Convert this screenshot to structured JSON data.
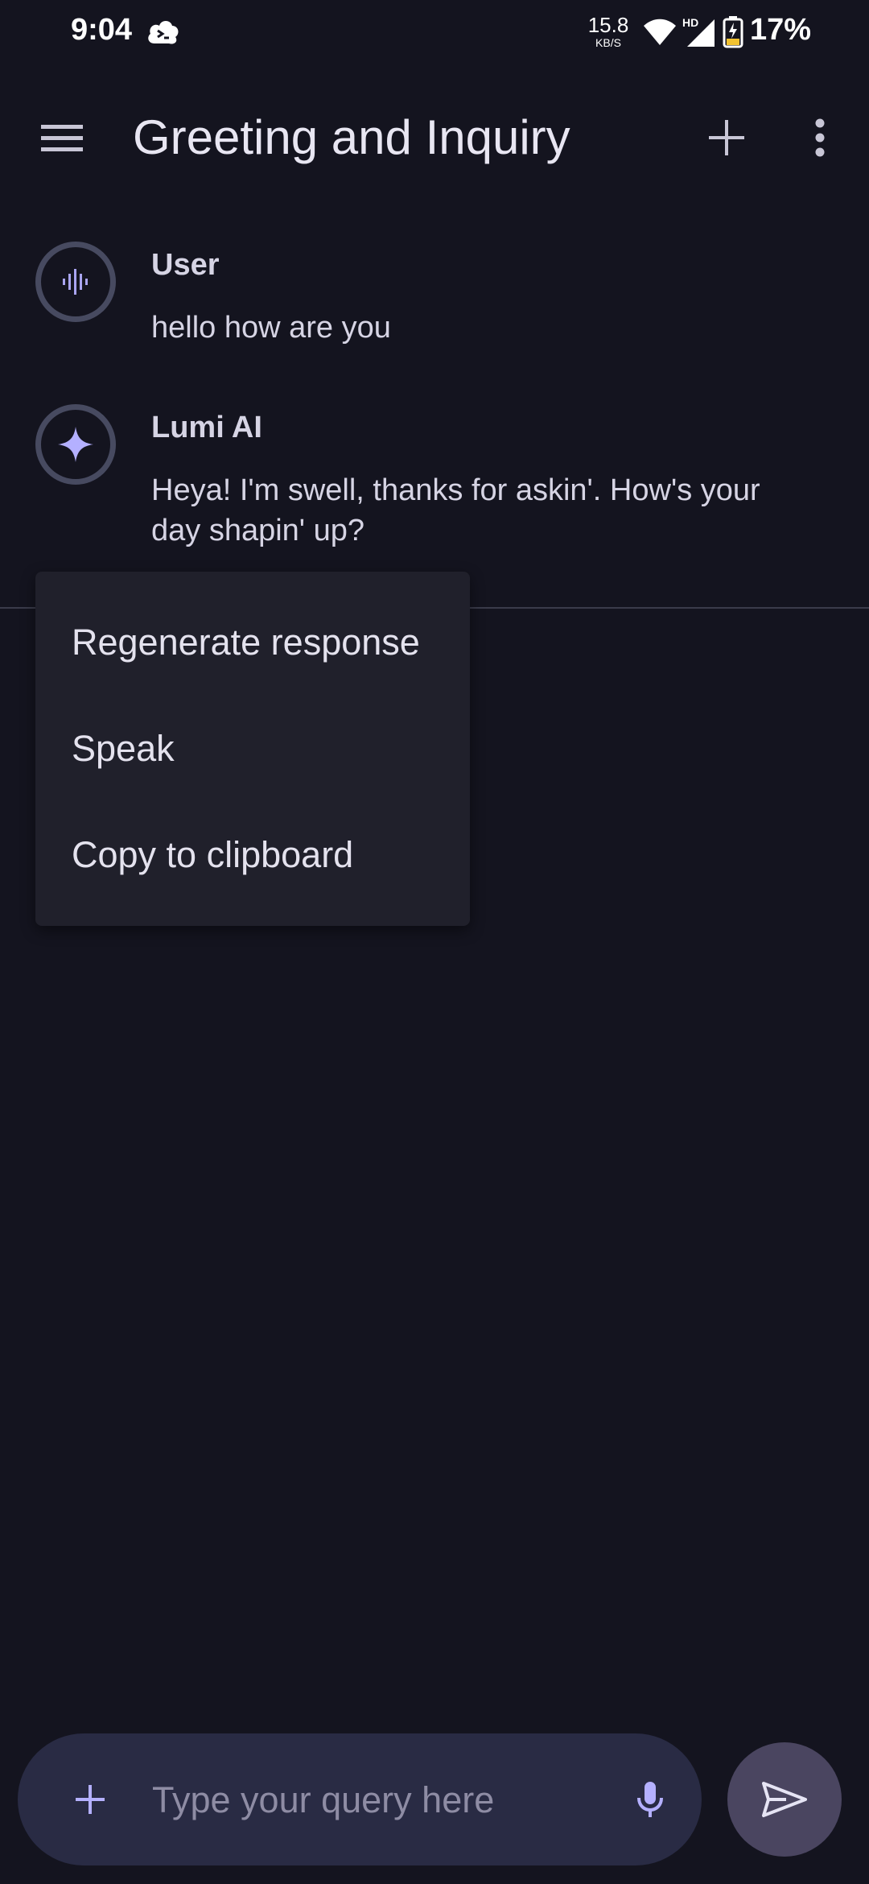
{
  "status_bar": {
    "time": "9:04",
    "network_speed_value": "15.8",
    "network_speed_unit": "KB/S",
    "network_type": "HD",
    "battery_percent": "17%",
    "icons": [
      "cloud-app-icon",
      "wifi-icon",
      "signal-icon",
      "battery-charging-icon"
    ]
  },
  "top_bar": {
    "title": "Greeting and Inquiry",
    "icons": [
      "hamburger-menu-icon",
      "plus-icon",
      "more-vert-icon"
    ]
  },
  "messages": [
    {
      "sender": "User",
      "text": "hello how are you",
      "avatar_icon": "audio-waveform-icon"
    },
    {
      "sender": "Lumi AI",
      "text": "Heya! I'm swell, thanks for askin'. How's your day shapin' up?",
      "avatar_icon": "sparkle-icon"
    }
  ],
  "context_menu": {
    "items": [
      {
        "label": "Regenerate response"
      },
      {
        "label": "Speak"
      },
      {
        "label": "Copy to clipboard"
      }
    ]
  },
  "input": {
    "placeholder": "Type your query here",
    "value": "",
    "icons": [
      "plus-icon",
      "mic-icon",
      "send-icon"
    ]
  },
  "colors": {
    "background": "#14141f",
    "accent": "#b4b0ff",
    "input_bar": "#292b44",
    "send_button": "#4a4560",
    "menu_surface": "#20202b"
  }
}
